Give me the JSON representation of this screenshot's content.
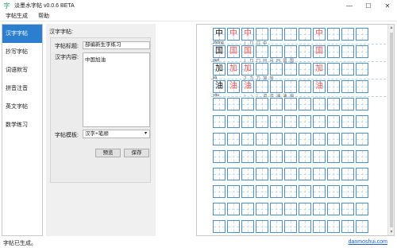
{
  "window": {
    "icon_glyph": "字",
    "title": "淡墨水字帖 v0.0.6 BETA",
    "minimize": "—",
    "maximize": "☐",
    "close": "✕"
  },
  "menu": [
    "字帖生成",
    "帮助"
  ],
  "sidebar": {
    "items": [
      {
        "label": "汉字字帖",
        "active": true
      },
      {
        "label": "抄写字帖",
        "active": false
      },
      {
        "label": "词语默写",
        "active": false
      },
      {
        "label": "拼音注音",
        "active": false
      },
      {
        "label": "英文字帖",
        "active": false
      },
      {
        "label": "数学练习",
        "active": false
      }
    ]
  },
  "form": {
    "panel_title": "汉字字帖:",
    "title_label": "字帖标题:",
    "title_value": "部编新生字练习",
    "content_label": "汉字内容:",
    "content_value": "中国加油",
    "template_label": "字帖模板:",
    "template_value": "汉字+笔顺",
    "preview_button": "预览",
    "save_button": "保存"
  },
  "preview": {
    "rows": [
      {
        "char": "中",
        "pinyin": "zhōng",
        "strokes": "丨 ㄇ 口 中"
      },
      {
        "char": "国",
        "pinyin": "guó",
        "strokes": "丨 ㄇ 冂 冃 月 冃 国 国"
      },
      {
        "char": "加",
        "pinyin": "jiā",
        "strokes": "フ 力 力 加 加"
      },
      {
        "char": "油",
        "pinyin": "yóu",
        "strokes": "丶 丶 氵 汩 汩 油 油 油"
      }
    ]
  },
  "status": {
    "text": "字帖已生成。",
    "link": "danmoshui.com"
  }
}
